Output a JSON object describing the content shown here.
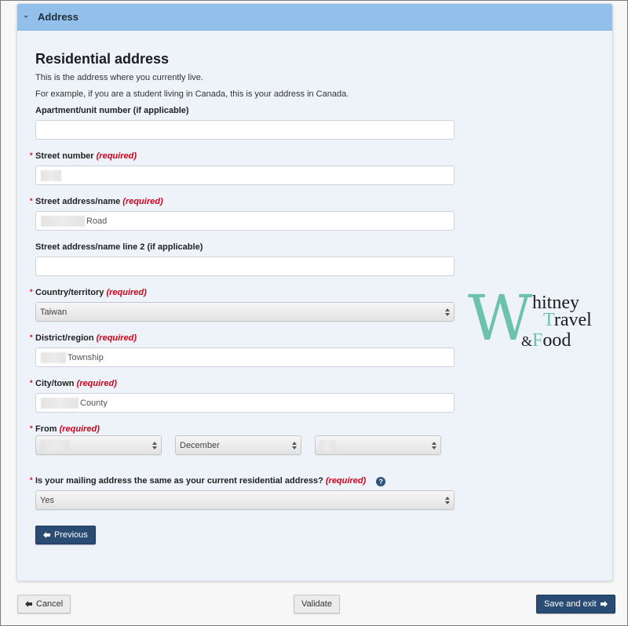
{
  "panel": {
    "title": "Address"
  },
  "section": {
    "heading": "Residential address",
    "intro1": "This is the address where you currently live.",
    "intro2": "For example, if you are a student living in Canada, this is your address in Canada."
  },
  "required_text": "(required)",
  "fields": {
    "apartment": {
      "label": "Apartment/unit number (if applicable)",
      "value": ""
    },
    "street_number": {
      "label": "Street number",
      "value": ""
    },
    "street_name": {
      "label": "Street address/name",
      "value_suffix": "Road"
    },
    "street_line2": {
      "label": "Street address/name line 2 (if applicable)",
      "value": ""
    },
    "country": {
      "label": "Country/territory",
      "value": "Taiwan"
    },
    "district": {
      "label": "District/region",
      "value_suffix": "Township"
    },
    "city": {
      "label": "City/town",
      "value_suffix": "County"
    },
    "from": {
      "label": "From",
      "year": "",
      "month": "December",
      "day": ""
    },
    "mailing_same": {
      "label": "Is your mailing address the same as your current residential address?",
      "value": "Yes",
      "help_icon": "?"
    }
  },
  "buttons": {
    "previous": "Previous",
    "cancel": "Cancel",
    "validate": "Validate",
    "save_exit": "Save and exit"
  },
  "watermark": {
    "big_letter": "W",
    "line1": "hitney",
    "line2_accent": "T",
    "line2": "ravel",
    "line3_amp": "&",
    "line3_accent": "F",
    "line3": "ood"
  },
  "colors": {
    "header_bg": "#93c0ea",
    "primary_button": "#2a4b74",
    "required_red": "#d0021b",
    "logo_teal": "#6cc2ad"
  }
}
